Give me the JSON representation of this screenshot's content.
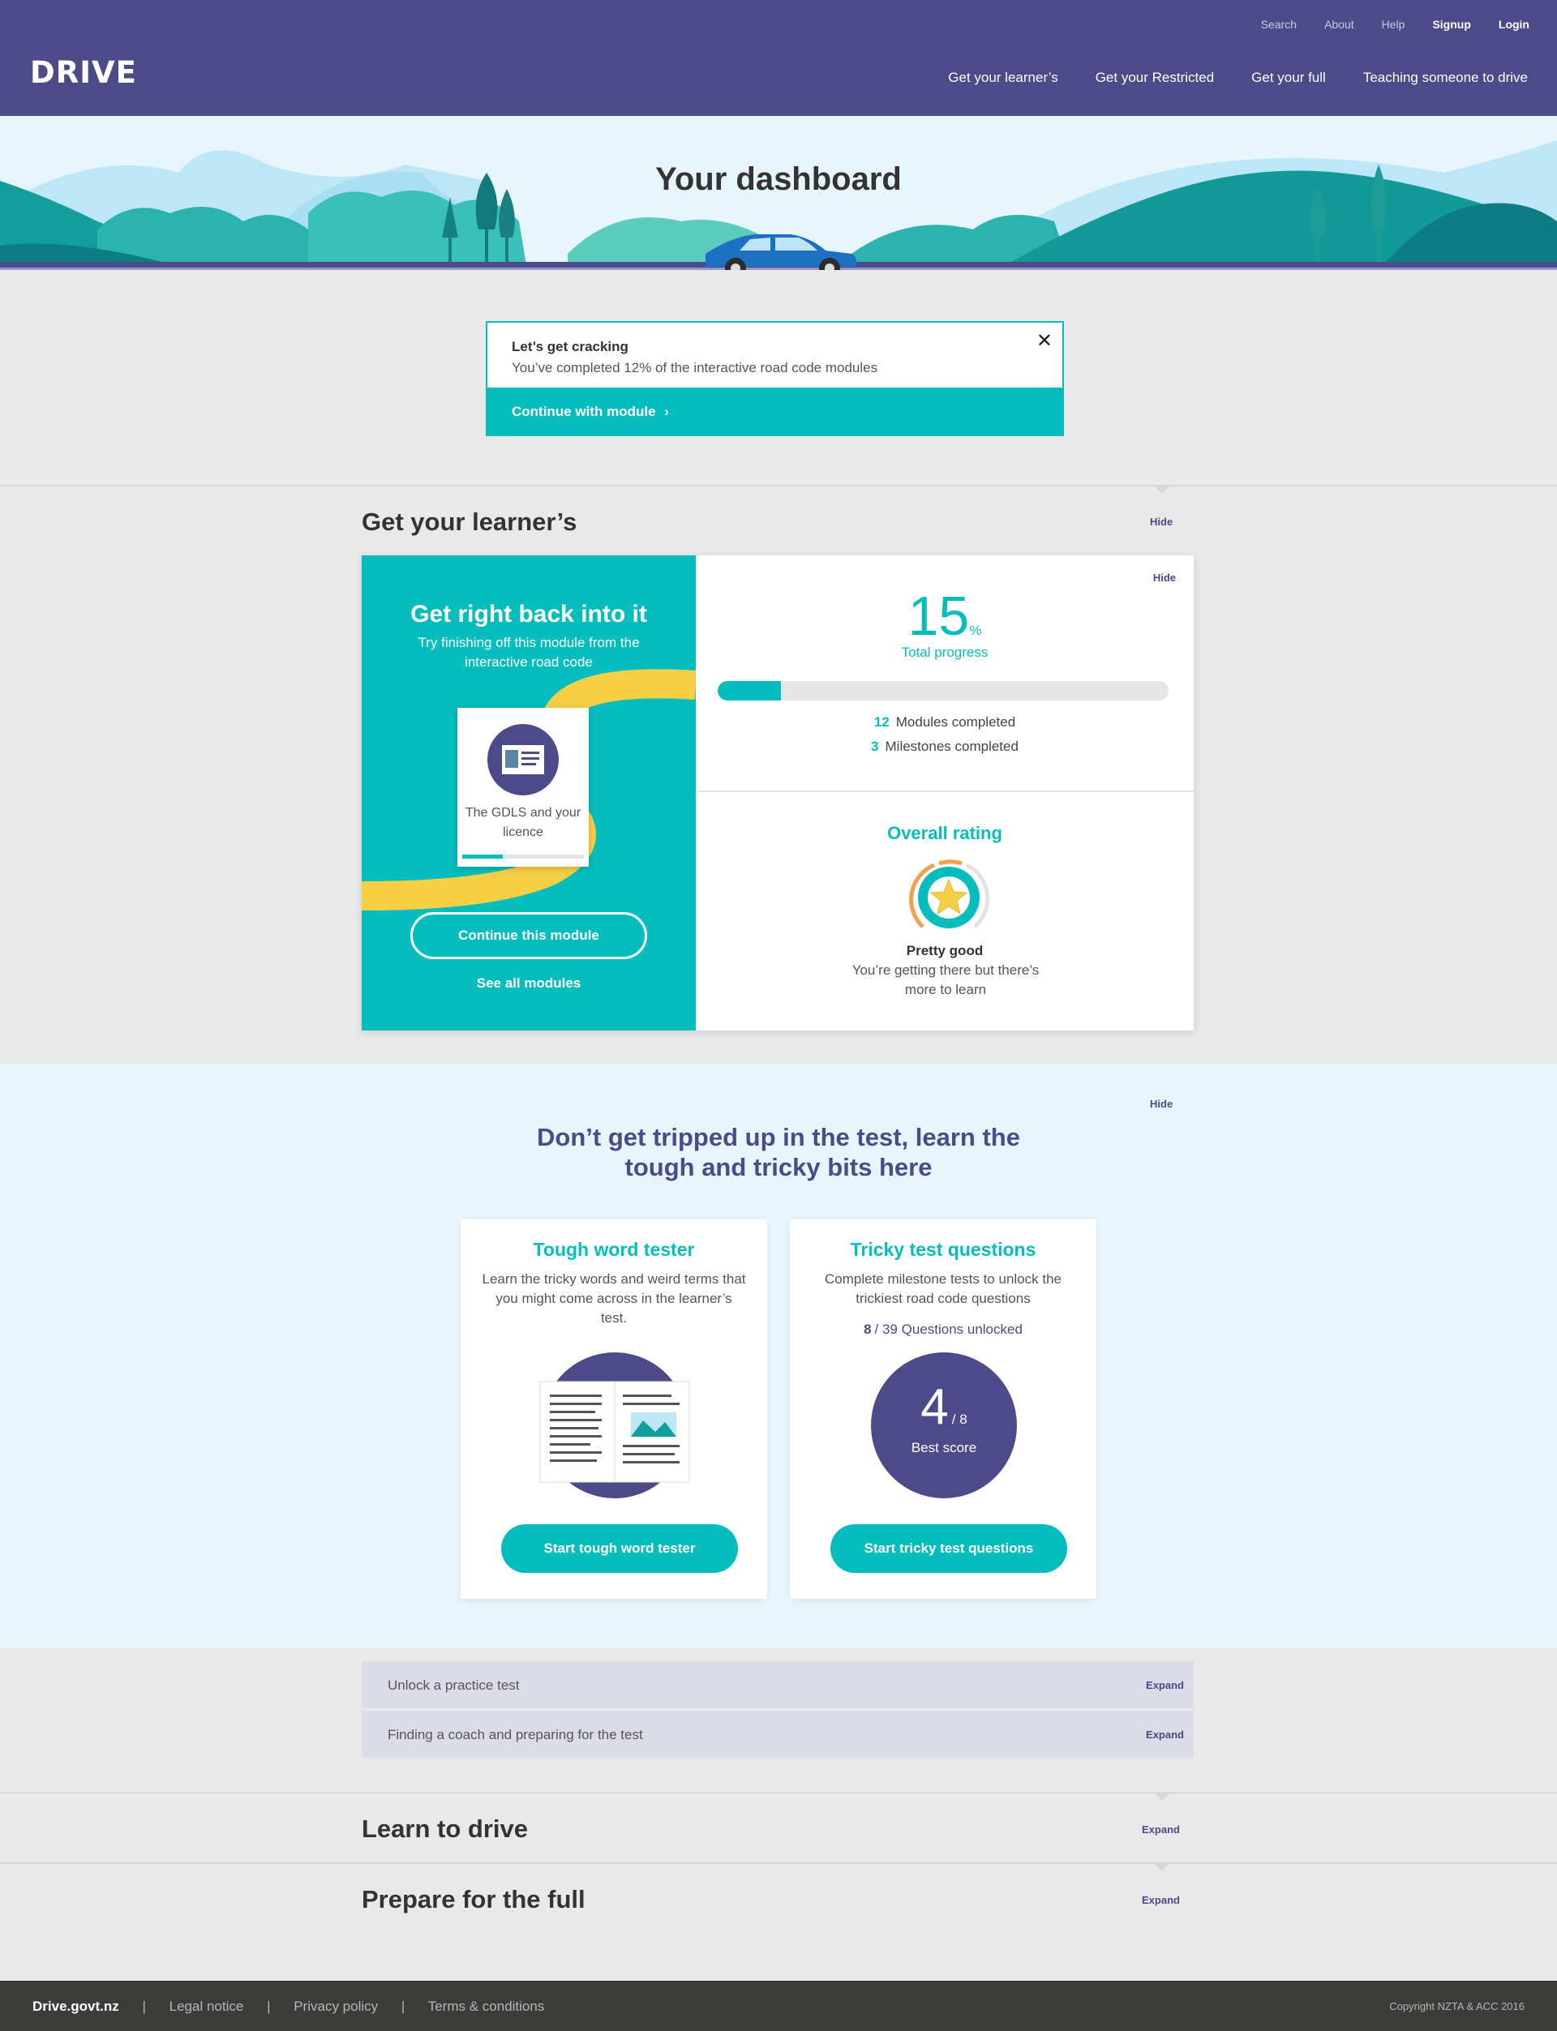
{
  "header": {
    "logo": "DRIVE",
    "util_nav": [
      {
        "label": "Search",
        "strong": false
      },
      {
        "label": "About",
        "strong": false
      },
      {
        "label": "Help",
        "strong": false
      },
      {
        "label": "Signup",
        "strong": true
      },
      {
        "label": "Login",
        "strong": true
      }
    ],
    "main_nav": [
      "Get your learner’s",
      "Get your Restricted",
      "Get your full",
      "Teaching someone to drive"
    ]
  },
  "hero": {
    "title": "Your dashboard"
  },
  "notice": {
    "title": "Let’s get cracking",
    "text": "You’ve completed 12% of the interactive road code modules",
    "cta": "Continue with module",
    "close_icon": "close-icon"
  },
  "learners": {
    "title": "Get your learner’s",
    "hide": "Hide",
    "card": {
      "heading": "Get right back into it",
      "sub": "Try finishing off this module from the interactive road code",
      "module_title": "The GDLS and your licence",
      "module_progress": 0.33,
      "continue": "Continue this module",
      "see_all": "See all modules",
      "hide": "Hide",
      "progress_value": "15",
      "progress_unit": "%",
      "progress_fraction": 0.14,
      "progress_label": "Total progress",
      "modules_count": "12",
      "modules_label": "Modules completed",
      "milestones_count": "3",
      "milestones_label": "Milestones completed",
      "rating_title": "Overall rating",
      "rating_label": "Pretty good",
      "rating_desc": "You’re getting there but there’s more to learn"
    }
  },
  "tricky": {
    "hide": "Hide",
    "heading_line1": "Don’t get tripped up in the test, learn the",
    "heading_line2": "tough and tricky bits here",
    "tough": {
      "title": "Tough word tester",
      "desc": "Learn the tricky words and weird terms that you might come across in the learner’s test.",
      "button": "Start tough word tester"
    },
    "questions": {
      "title": "Tricky test questions",
      "desc": "Complete milestone tests to unlock the trickiest road code questions",
      "unlocked_count": "8",
      "unlocked_text": "/ 39 Questions unlocked",
      "score": "4",
      "score_of": "/ 8",
      "score_label": "Best score",
      "button": "Start tricky test questions"
    }
  },
  "accordion": [
    {
      "label": "Unlock a practice test",
      "action": "Expand"
    },
    {
      "label": "Finding a coach and preparing for the test",
      "action": "Expand"
    }
  ],
  "sections": {
    "learn": {
      "title": "Learn to drive",
      "action": "Expand"
    },
    "full": {
      "title": "Prepare for the full",
      "action": "Expand"
    }
  },
  "footer": {
    "brand": "Drive.govt.nz",
    "links": [
      "Legal notice",
      "Privacy policy",
      "Terms & conditions"
    ],
    "separator": "|",
    "copyright": "Copyright NZTA & ACC 2016"
  },
  "colors": {
    "brand_purple": "#4c4a88",
    "teal": "#06bdbd",
    "yellow": "#f7cf45",
    "bg_grey": "#e9e9e9",
    "light_blue": "#e7f6fd"
  }
}
